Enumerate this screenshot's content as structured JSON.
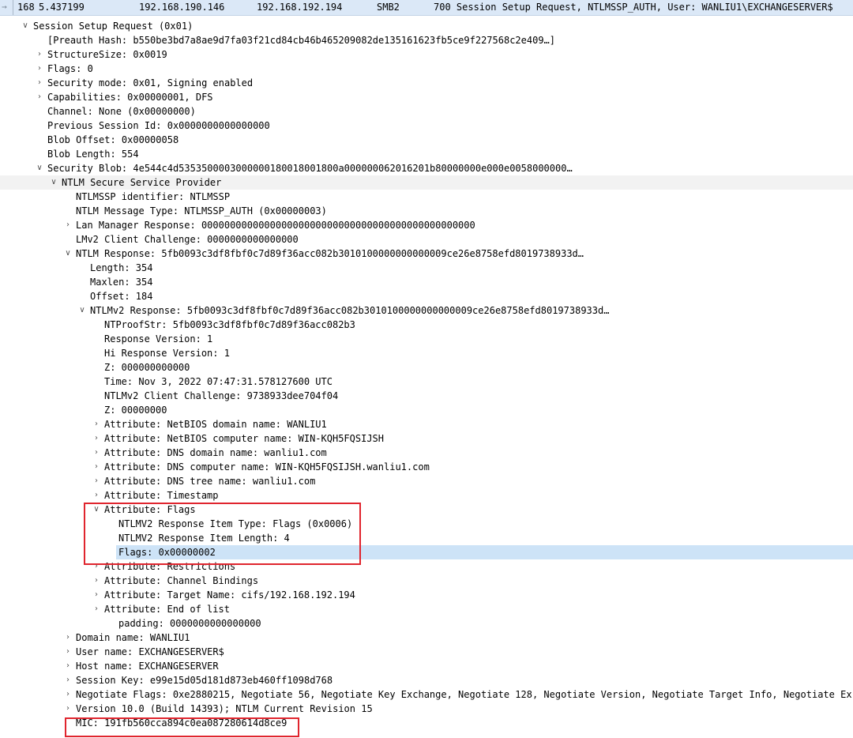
{
  "packet_list_row": {
    "number": "168",
    "time": "5.437199",
    "source": "192.168.190.146",
    "destination": "192.168.192.194",
    "protocol": "SMB2",
    "length_info": "700 Session Setup Request, NTLMSSP_AUTH, User: WANLIU1\\EXCHANGESERVER$"
  },
  "icons": {
    "expanded": "chevron-down-icon",
    "collapsed": "chevron-right-icon"
  },
  "tree": [
    {
      "text": "Session Setup Request (0x01)",
      "level": 0,
      "toggle": "expanded"
    },
    {
      "text": "[Preauth Hash: b550be3bd7a8ae9d7fa03f21cd84cb46b465209082de135161623fb5ce9f227568c2e409…]",
      "level": 1,
      "toggle": "none"
    },
    {
      "text": "StructureSize: 0x0019",
      "level": 1,
      "toggle": "collapsed"
    },
    {
      "text": "Flags: 0",
      "level": 1,
      "toggle": "collapsed"
    },
    {
      "text": "Security mode: 0x01, Signing enabled",
      "level": 1,
      "toggle": "collapsed"
    },
    {
      "text": "Capabilities: 0x00000001, DFS",
      "level": 1,
      "toggle": "collapsed"
    },
    {
      "text": "Channel: None (0x00000000)",
      "level": 1,
      "toggle": "none"
    },
    {
      "text": "Previous Session Id: 0x0000000000000000",
      "level": 1,
      "toggle": "none"
    },
    {
      "text": "Blob Offset: 0x00000058",
      "level": 1,
      "toggle": "none"
    },
    {
      "text": "Blob Length: 554",
      "level": 1,
      "toggle": "none"
    },
    {
      "text": "Security Blob: 4e544c4d5353500003000000180018001800a000000062016201b80000000e000e0058000000…",
      "level": 1,
      "toggle": "expanded"
    },
    {
      "text": "NTLM Secure Service Provider",
      "level": 2,
      "toggle": "expanded",
      "selected_light": true
    },
    {
      "text": "NTLMSSP identifier: NTLMSSP",
      "level": 3,
      "toggle": "none"
    },
    {
      "text": "NTLM Message Type: NTLMSSP_AUTH (0x00000003)",
      "level": 3,
      "toggle": "none"
    },
    {
      "text": "Lan Manager Response: 000000000000000000000000000000000000000000000000",
      "level": 3,
      "toggle": "collapsed"
    },
    {
      "text": "LMv2 Client Challenge: 0000000000000000",
      "level": 3,
      "toggle": "none"
    },
    {
      "text": "NTLM Response: 5fb0093c3df8fbf0c7d89f36acc082b3010100000000000009ce26e8758efd8019738933d…",
      "level": 3,
      "toggle": "expanded"
    },
    {
      "text": "Length: 354",
      "level": 4,
      "toggle": "none"
    },
    {
      "text": "Maxlen: 354",
      "level": 4,
      "toggle": "none"
    },
    {
      "text": "Offset: 184",
      "level": 4,
      "toggle": "none"
    },
    {
      "text": "NTLMv2 Response: 5fb0093c3df8fbf0c7d89f36acc082b3010100000000000009ce26e8758efd8019738933d…",
      "level": 4,
      "toggle": "expanded"
    },
    {
      "text": "NTProofStr: 5fb0093c3df8fbf0c7d89f36acc082b3",
      "level": 5,
      "toggle": "none"
    },
    {
      "text": "Response Version: 1",
      "level": 5,
      "toggle": "none"
    },
    {
      "text": "Hi Response Version: 1",
      "level": 5,
      "toggle": "none"
    },
    {
      "text": "Z: 000000000000",
      "level": 5,
      "toggle": "none"
    },
    {
      "text": "Time: Nov  3, 2022 07:47:31.578127600 UTC",
      "level": 5,
      "toggle": "none"
    },
    {
      "text": "NTLMv2 Client Challenge: 9738933dee704f04",
      "level": 5,
      "toggle": "none"
    },
    {
      "text": "Z: 00000000",
      "level": 5,
      "toggle": "none"
    },
    {
      "text": "Attribute: NetBIOS domain name: WANLIU1",
      "level": 5,
      "toggle": "collapsed"
    },
    {
      "text": "Attribute: NetBIOS computer name: WIN-KQH5FQSIJSH",
      "level": 5,
      "toggle": "collapsed"
    },
    {
      "text": "Attribute: DNS domain name: wanliu1.com",
      "level": 5,
      "toggle": "collapsed"
    },
    {
      "text": "Attribute: DNS computer name: WIN-KQH5FQSIJSH.wanliu1.com",
      "level": 5,
      "toggle": "collapsed"
    },
    {
      "text": "Attribute: DNS tree name: wanliu1.com",
      "level": 5,
      "toggle": "collapsed"
    },
    {
      "text": "Attribute: Timestamp",
      "level": 5,
      "toggle": "collapsed"
    },
    {
      "text": "Attribute: Flags",
      "level": 5,
      "toggle": "expanded"
    },
    {
      "text": "NTLMV2 Response Item Type: Flags (0x0006)",
      "level": 6,
      "toggle": "none"
    },
    {
      "text": "NTLMV2 Response Item Length: 4",
      "level": 6,
      "toggle": "none"
    },
    {
      "text": "Flags: 0x00000002",
      "level": 6,
      "toggle": "none",
      "selected": true
    },
    {
      "text": "Attribute: Restrictions",
      "level": 5,
      "toggle": "collapsed"
    },
    {
      "text": "Attribute: Channel Bindings",
      "level": 5,
      "toggle": "collapsed"
    },
    {
      "text": "Attribute: Target Name: cifs/192.168.192.194",
      "level": 5,
      "toggle": "collapsed"
    },
    {
      "text": "Attribute: End of list",
      "level": 5,
      "toggle": "collapsed"
    },
    {
      "text": "padding: 0000000000000000",
      "level": 6,
      "toggle": "none"
    },
    {
      "text": "Domain name: WANLIU1",
      "level": 3,
      "toggle": "collapsed"
    },
    {
      "text": "User name: EXCHANGESERVER$",
      "level": 3,
      "toggle": "collapsed"
    },
    {
      "text": "Host name: EXCHANGESERVER",
      "level": 3,
      "toggle": "collapsed"
    },
    {
      "text": "Session Key: e99e15d05d181d873eb460ff1098d768",
      "level": 3,
      "toggle": "collapsed"
    },
    {
      "text": "Negotiate Flags: 0xe2880215, Negotiate 56, Negotiate Key Exchange, Negotiate 128, Negotiate Version, Negotiate Target Info, Negotiate Ex",
      "level": 3,
      "toggle": "collapsed"
    },
    {
      "text": "Version 10.0 (Build 14393); NTLM Current Revision 15",
      "level": 3,
      "toggle": "collapsed"
    },
    {
      "text": "MIC: 191fb560cca894c0ea087280614d8ce9",
      "level": 3,
      "toggle": "none"
    }
  ],
  "colors": {
    "annotation_box": "#e0252e",
    "selection": "#cde3f7",
    "packet_row_bg": "#dbe8f7"
  }
}
